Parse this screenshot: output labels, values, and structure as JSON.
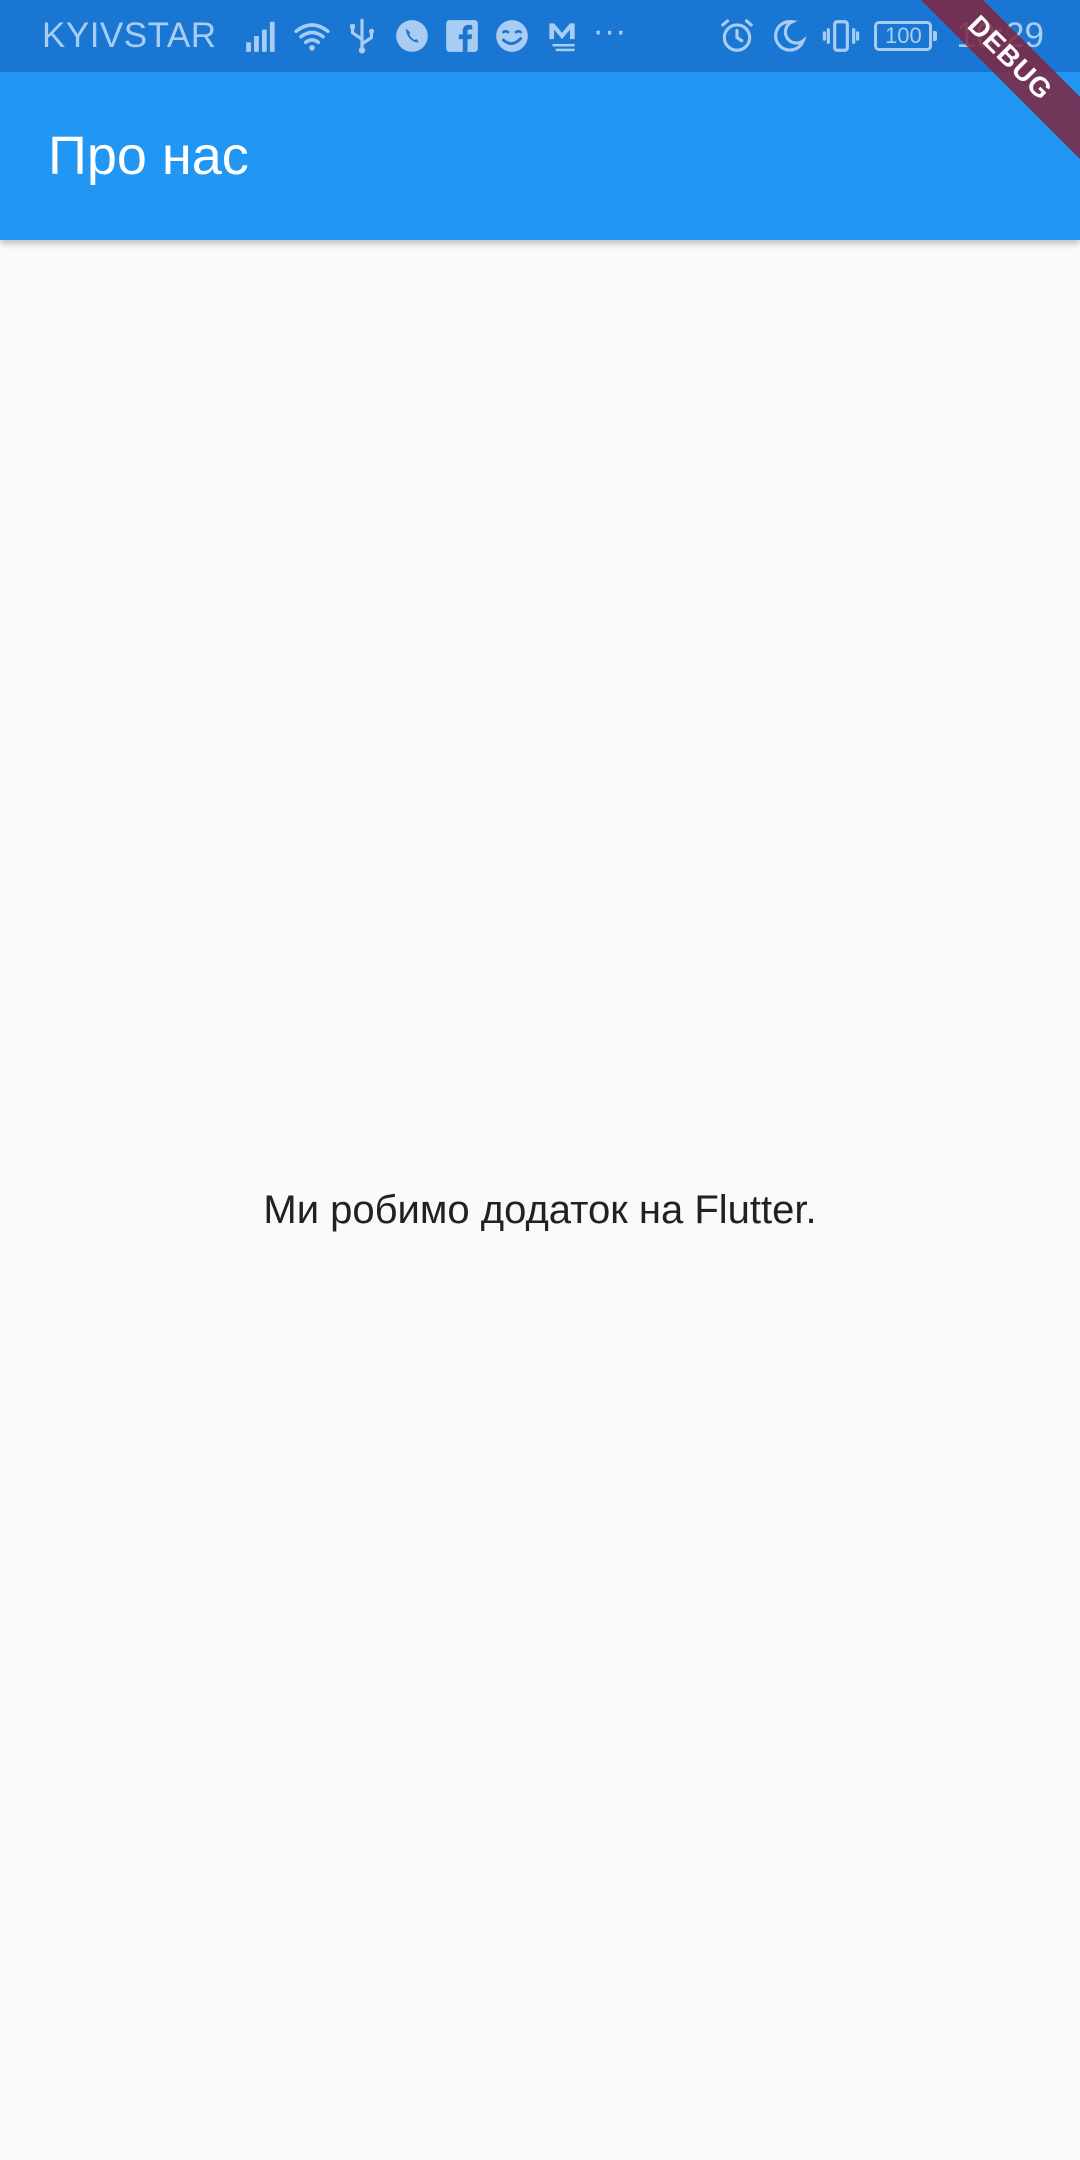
{
  "status_bar": {
    "carrier": "KYIVSTAR",
    "time": "10:29",
    "battery": "100",
    "left_icons": [
      "signal-icon",
      "wifi-icon",
      "usb-icon",
      "viber-icon",
      "facebook-icon",
      "troll-face-icon",
      "gmail-icon",
      "more-dots-icon"
    ],
    "right_icons": [
      "alarm-icon",
      "moon-icon",
      "vibrate-icon",
      "battery-icon"
    ],
    "more_glyph": "···"
  },
  "app_bar": {
    "title": "Про нас",
    "color": "#2196f3"
  },
  "body": {
    "text": "Ми робимо додаток на Flutter."
  },
  "debug_banner": {
    "label": "DEBUG"
  }
}
